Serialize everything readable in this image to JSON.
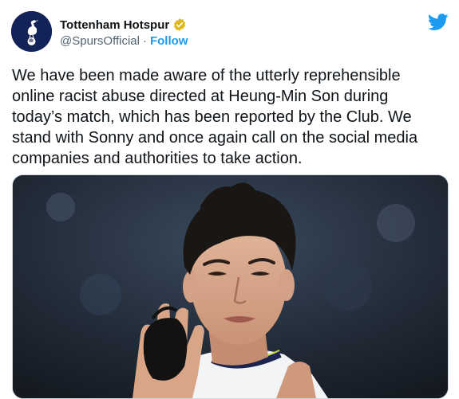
{
  "account": {
    "name": "Tottenham Hotspur",
    "handle": "@SpursOfficial",
    "separator": "·",
    "follow_label": "Follow",
    "verified_color": "#e2b719",
    "avatar_icon": "spurs-crest-icon"
  },
  "brand": {
    "twitter_icon": "twitter-bird-icon",
    "twitter_blue": "#1d9bf0"
  },
  "tweet": {
    "text": "We have been made aware of the utterly reprehensible\nonline racist abuse directed at Heung-Min Son during\ntoday’s match, which has been reported by the Club. We\nstand with Sonny and once again call on the social media\ncompanies and authorities to take action."
  },
  "media": {
    "type": "photo",
    "subject": "player-photo"
  }
}
